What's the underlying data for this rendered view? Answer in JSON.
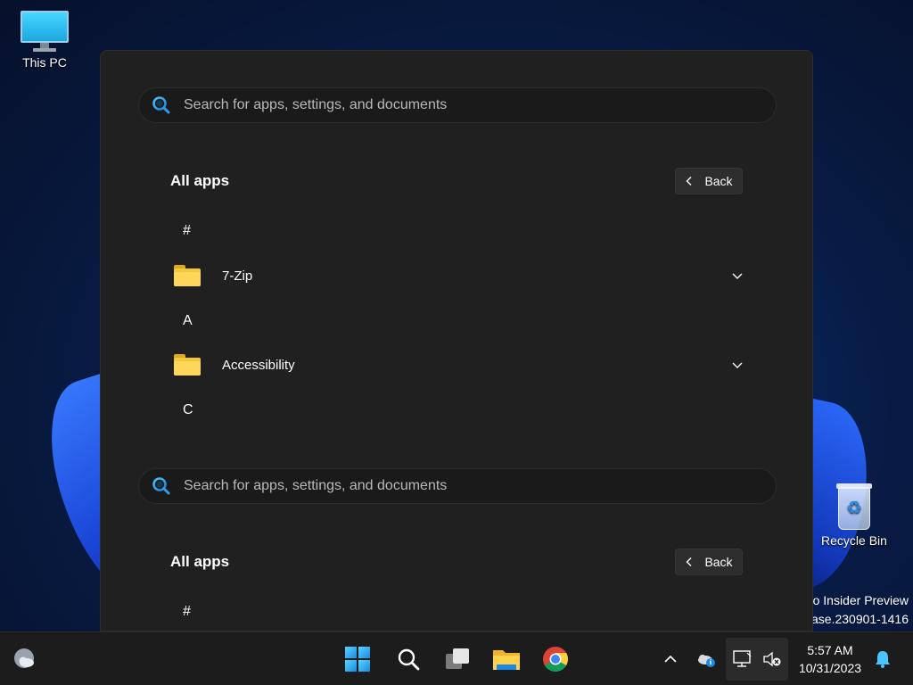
{
  "desktop": {
    "this_pc_label": "This PC",
    "recycle_bin_label": "Recycle Bin",
    "watermark_line1": "o Insider Preview",
    "watermark_line2": "ase.230901-1416"
  },
  "start_menu": {
    "search_placeholder": "Search for apps, settings, and documents",
    "all_apps_title": "All apps",
    "back_label": "Back",
    "sections": [
      {
        "letter": "#",
        "apps": [
          {
            "name": "7-Zip",
            "icon": "folder-icon",
            "expandable": true
          }
        ]
      },
      {
        "letter": "A",
        "apps": [
          {
            "name": "Accessibility",
            "icon": "folder-icon",
            "expandable": true
          }
        ]
      },
      {
        "letter": "C",
        "apps": []
      }
    ],
    "duplicate_search_placeholder": "Search for apps, settings, and documents",
    "duplicate_all_apps_title": "All apps",
    "duplicate_back_label": "Back",
    "duplicate_first_letter": "#"
  },
  "taskbar": {
    "pinned": [
      "weather-icon",
      "windows-start-icon",
      "search-icon",
      "task-view-icon",
      "file-explorer-icon",
      "chrome-icon"
    ],
    "tray_icons": [
      "chevron-up-icon",
      "onedrive-icon",
      "network-icon",
      "volume-muted-icon",
      "notification-bell-icon"
    ],
    "time": "5:57 AM",
    "date": "10/31/2023"
  },
  "colors": {
    "start_background": "#202020",
    "search_background": "#1a1a1a",
    "accent": "#4cc2ff",
    "folder_yellow": "#f5c83c"
  }
}
